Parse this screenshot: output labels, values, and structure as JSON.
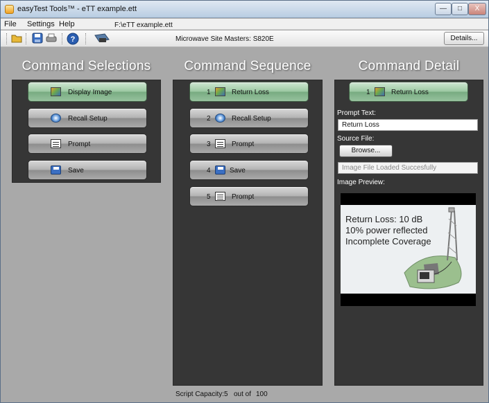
{
  "window": {
    "title": "easyTest Tools™ - eTT example.ett",
    "min_glyph": "—",
    "max_glyph": "□",
    "close_glyph": "X"
  },
  "menu": {
    "items": [
      "File",
      "Settings",
      "Help"
    ],
    "file_path": "F:\\eTT example.ett"
  },
  "toolbar": {
    "device": "Microwave Site Masters: S820E",
    "details_label": "Details..."
  },
  "selections": {
    "title": "Command Selections",
    "items": [
      {
        "label": "Display Image",
        "icon": "image-icon"
      },
      {
        "label": "Recall Setup",
        "icon": "recall-icon"
      },
      {
        "label": "Prompt",
        "icon": "prompt-icon"
      },
      {
        "label": "Save",
        "icon": "save-icon"
      }
    ]
  },
  "sequence": {
    "title": "Command Sequence",
    "items": [
      {
        "num": "1",
        "label": "Return Loss",
        "icon": "image-icon"
      },
      {
        "num": "2",
        "label": "Recall Setup",
        "icon": "recall-icon"
      },
      {
        "num": "3",
        "label": "Prompt",
        "icon": "prompt-icon"
      },
      {
        "num": "4",
        "label": "Save",
        "icon": "save-icon"
      },
      {
        "num": "5",
        "label": "Prompt",
        "icon": "prompt-icon"
      }
    ],
    "capacity_label": "Script Capacity:",
    "capacity_used": "5",
    "capacity_sep": "out of",
    "capacity_total": "100"
  },
  "detail": {
    "title": "Command Detail",
    "selected_num": "1",
    "selected_label": "Return Loss",
    "prompt_text_label": "Prompt Text:",
    "prompt_text_value": "Return Loss",
    "source_file_label": "Source File:",
    "browse_label": "Browse...",
    "status_value": "Image File Loaded Succesfully",
    "preview_label": "Image Preview:",
    "preview_lines": [
      "Return Loss: 10 dB",
      "10% power reflected",
      "Incomplete Coverage"
    ]
  },
  "colors": {
    "panel_bg": "#363636",
    "window_bg": "#a9a9a9",
    "selected_button": "#9cc9a3"
  }
}
